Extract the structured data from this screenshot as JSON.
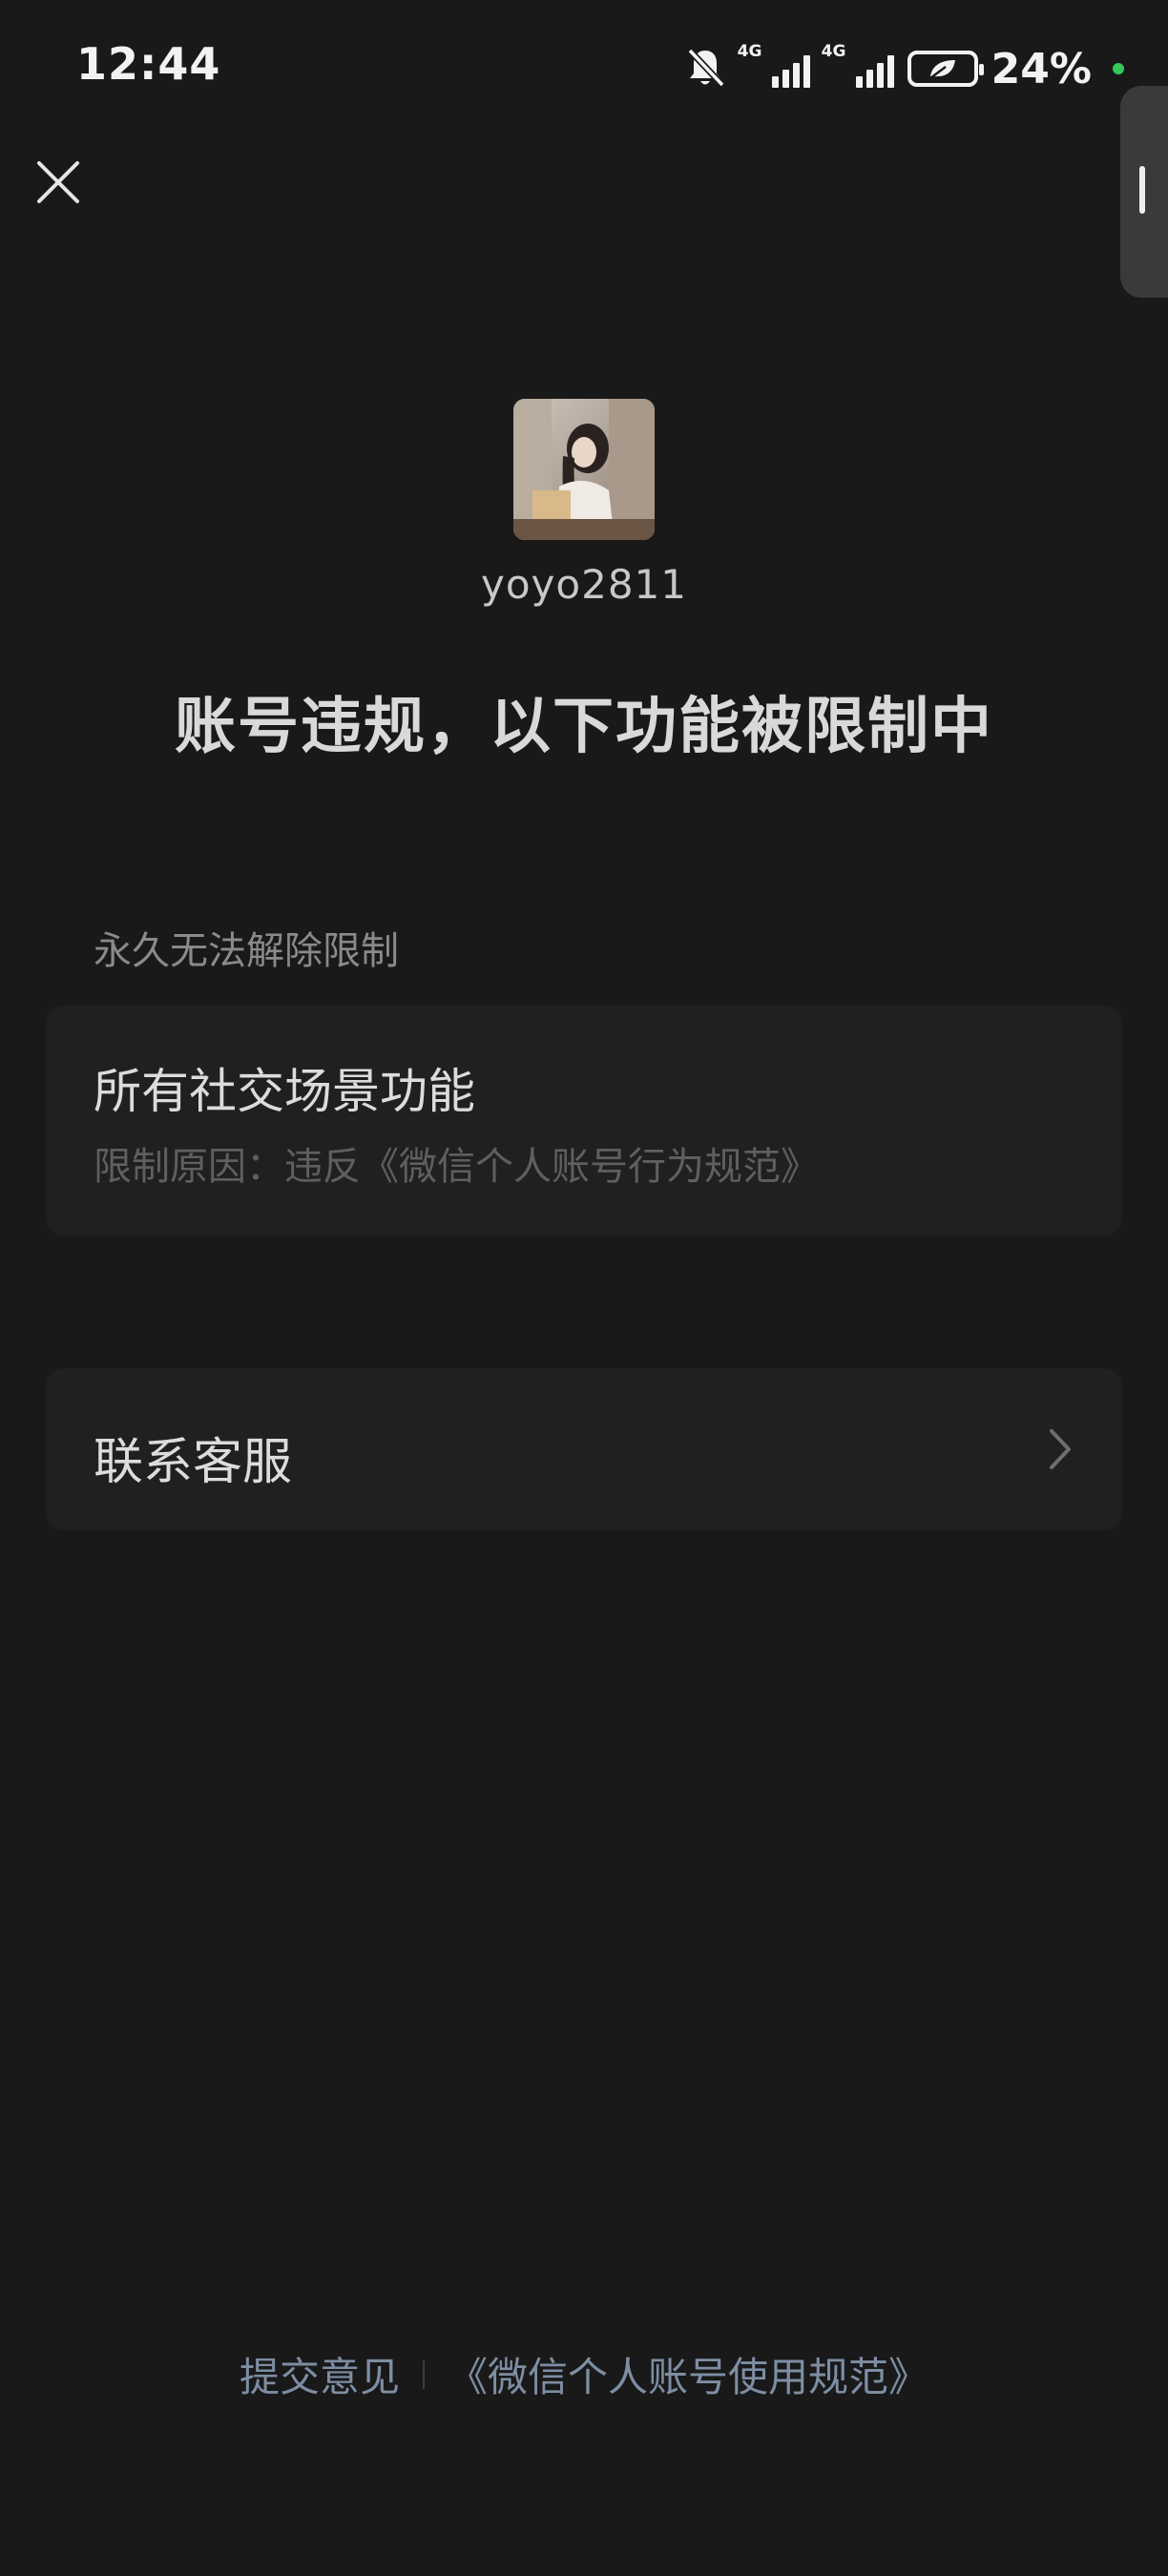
{
  "status_bar": {
    "time": "12:44",
    "network_1": "4G",
    "network_2": "4G",
    "battery": "24%",
    "icons": [
      "bell-muted-icon",
      "signal-icon",
      "signal-icon",
      "battery-leaf-icon"
    ],
    "dot_color": "#34c759"
  },
  "profile": {
    "username": "yoyo2811"
  },
  "headline": "账号违规，以下功能被限制中",
  "restriction_section": {
    "label": "永久无法解除限制",
    "item_title": "所有社交场景功能",
    "item_reason": "限制原因：违反《微信个人账号行为规范》"
  },
  "contact": {
    "label": "联系客服"
  },
  "footer": {
    "feedback": "提交意见",
    "policy_link": "《微信个人账号使用规范》"
  },
  "colors": {
    "background": "#191919",
    "card": "#202020",
    "link": "#7d8ea3"
  }
}
